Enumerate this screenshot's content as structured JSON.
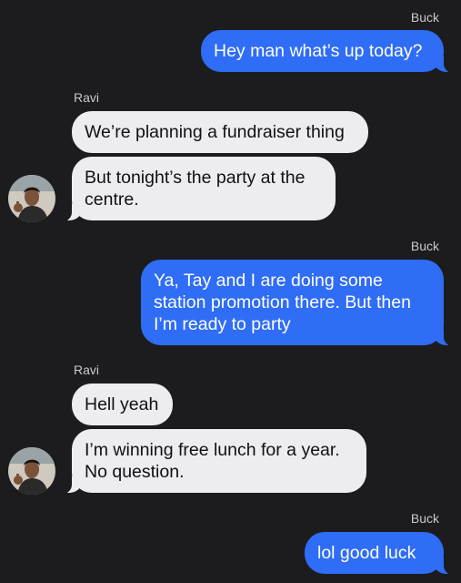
{
  "conversation": {
    "messages": [
      {
        "sender": "Buck",
        "text": "Hey man what’s up today?"
      },
      {
        "sender": "Ravi",
        "text": "We’re planning a fundraiser thing"
      },
      {
        "text_line1": "But tonight’s the party at the",
        "text_line2": "centre."
      },
      {
        "sender": "Buck",
        "text_line1": "Ya, Tay and I are doing some",
        "text_line2": "station promotion there. But then",
        "text_line3": "I’m ready to party"
      },
      {
        "sender": "Ravi",
        "text": "Hell yeah"
      },
      {
        "text_line1": "I’m winning free lunch for a year.",
        "text_line2": "No question."
      },
      {
        "sender": "Buck",
        "text": "lol good luck"
      }
    ]
  },
  "colors": {
    "background": "#1c1c1e",
    "outgoing_bubble": "#2f6df6",
    "incoming_bubble": "#ececf1",
    "sender_label": "#c9c9cc"
  },
  "icons": [
    "contact-avatar-ravi"
  ]
}
